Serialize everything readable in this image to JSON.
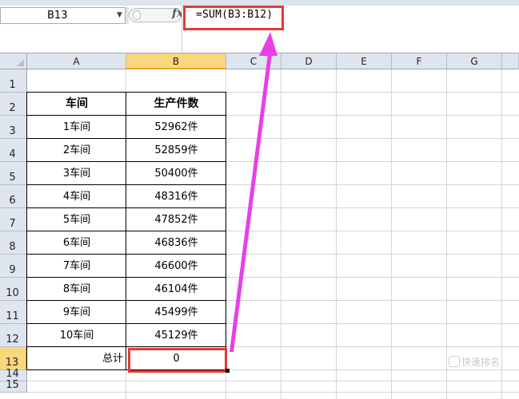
{
  "formula_bar": {
    "name_box": "B13",
    "fx_label": "fx",
    "formula": "=SUM(B3:B12)"
  },
  "columns": [
    "A",
    "B",
    "C",
    "D",
    "E",
    "F",
    "G"
  ],
  "rows": [
    "1",
    "2",
    "3",
    "4",
    "5",
    "6",
    "7",
    "8",
    "9",
    "10",
    "11",
    "12",
    "13",
    "14",
    "15"
  ],
  "table": {
    "headers": [
      "车间",
      "生产件数"
    ],
    "rows": [
      [
        "1车间",
        "52962件"
      ],
      [
        "2车间",
        "52859件"
      ],
      [
        "3车间",
        "50400件"
      ],
      [
        "4车间",
        "48316件"
      ],
      [
        "5车间",
        "47852件"
      ],
      [
        "6车间",
        "46836件"
      ],
      [
        "7车间",
        "46600件"
      ],
      [
        "8车间",
        "46104件"
      ],
      [
        "9车间",
        "45499件"
      ],
      [
        "10车间",
        "45129件"
      ]
    ],
    "total_label": "总计",
    "total_value": "0"
  },
  "selected_cell": "B13",
  "annotation_color": "#e23b35",
  "arrow_color": "#e83fe8",
  "watermark": "快速排名"
}
